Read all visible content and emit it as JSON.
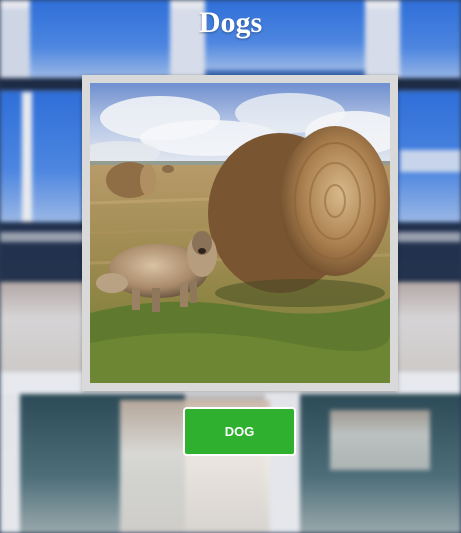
{
  "header": {
    "title": "Dogs"
  },
  "photo": {
    "subject": "dog-beside-hay-bale"
  },
  "actions": {
    "dog_button_label": "DOG"
  },
  "colors": {
    "button_background": "#2fb12f",
    "button_text": "#ffffff",
    "title_text": "#ffffff",
    "card_border": "#d9d9d9"
  }
}
